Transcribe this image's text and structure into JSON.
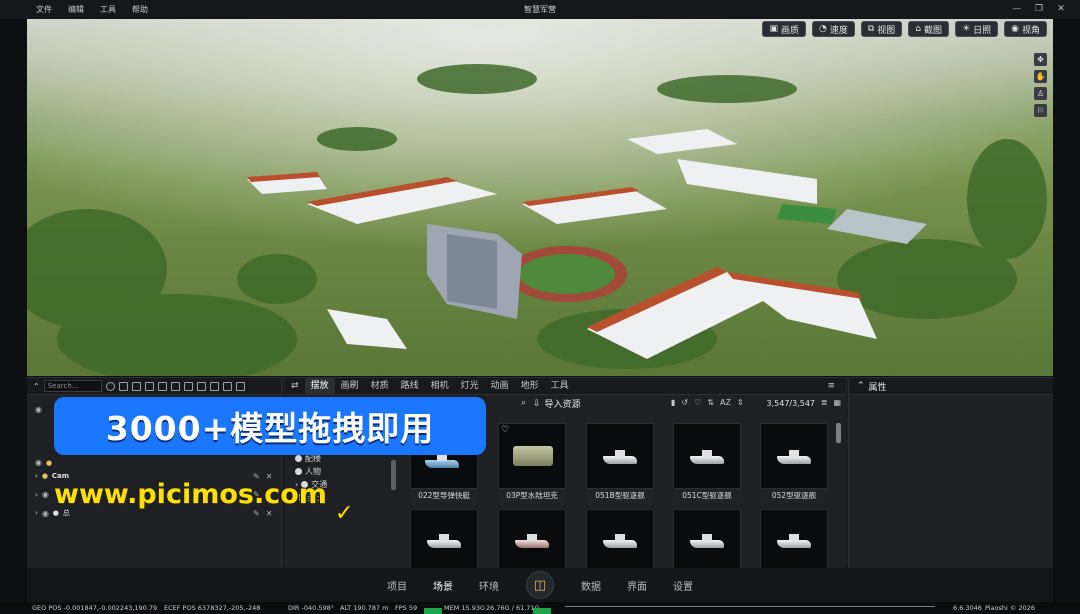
{
  "menu": [
    "文件",
    "编辑",
    "工具",
    "帮助"
  ],
  "app_title": "智慧军营",
  "viewport": {
    "buttons": [
      "画质",
      "速度",
      "视图",
      "截图",
      "日照",
      "视角"
    ]
  },
  "left_panel": {
    "search_placeholder": "Search...",
    "tree": [
      {
        "label": "Cam"
      },
      {
        "label": ""
      },
      {
        "label": "总"
      }
    ]
  },
  "mid_panel": {
    "tabs": [
      "摆放",
      "画刷",
      "材质",
      "路线",
      "相机",
      "灯光",
      "动画",
      "地形",
      "工具"
    ],
    "import_label": "导入资源",
    "count": "3,547/3,547",
    "categories": [
      "原生",
      "基础",
      "配楼",
      "人物",
      "交通",
      "岩石"
    ],
    "assets": [
      {
        "caption": "022型导弹快艇",
        "kind": "boat"
      },
      {
        "caption": "03P型水陆坦克",
        "kind": "tank"
      },
      {
        "caption": "051B型驱逐舰",
        "kind": "ship"
      },
      {
        "caption": "051C型驱逐舰",
        "kind": "ship"
      },
      {
        "caption": "052型驱逐舰",
        "kind": "ship"
      },
      {
        "caption": "",
        "kind": "ship"
      },
      {
        "caption": "",
        "kind": "ship"
      },
      {
        "caption": "",
        "kind": "ship"
      },
      {
        "caption": "",
        "kind": "ship"
      },
      {
        "caption": "",
        "kind": "ship"
      }
    ]
  },
  "right_panel": {
    "title": "属性"
  },
  "overlay": {
    "headline": "3000+模型拖拽即用",
    "url": "www.picimos.com"
  },
  "bottom_nav": {
    "left": [
      "项目",
      "场景",
      "环境"
    ],
    "right": [
      "数据",
      "界面",
      "设置"
    ],
    "active": "场景"
  },
  "status": {
    "geo_pos": "GEO POS  -0.001847,-0.002243,190.79",
    "ecef_pos": "ECEF POS  6378327,-205,-248",
    "dir": "DIR   -040.598°",
    "alt": "ALT   190.787 m",
    "fps": "FPS   59",
    "mem": "MEM   15.93G",
    "gpu": "26.76G / 61.71G",
    "version": "6.6.3046",
    "copyright": "Piaoshi © 2026"
  },
  "colors": {
    "accent": "#1b77ff",
    "url_yellow": "#ffe000"
  }
}
